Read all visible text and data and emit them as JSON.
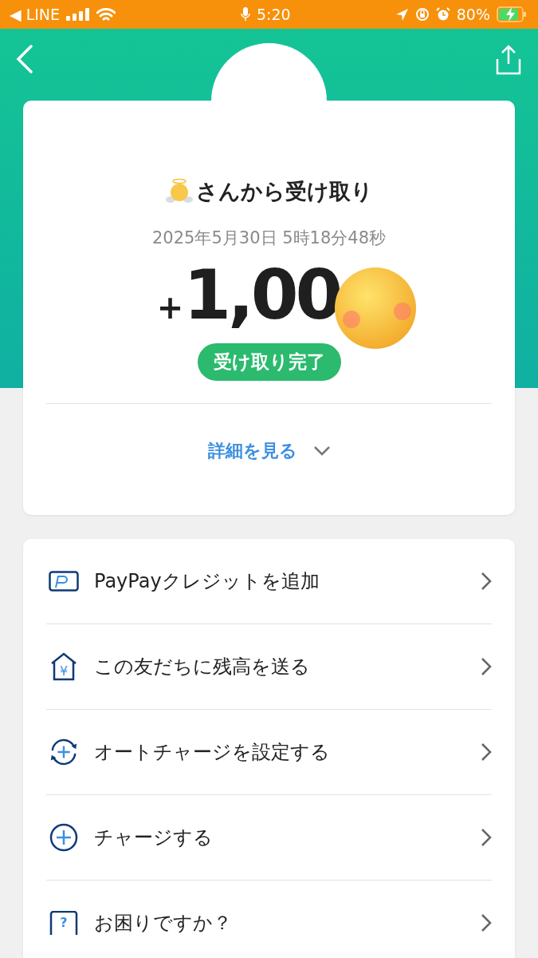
{
  "status_bar": {
    "back_app": "◀ LINE",
    "time": "5:20",
    "battery": "80%",
    "charging": true
  },
  "transaction": {
    "title": "さんから受け取り",
    "datetime": "2025年5月30日 5時18分48秒",
    "sign": "+",
    "amount": "1,00",
    "status": "受け取り完了",
    "details_link": "詳細を見る",
    "expanded": false
  },
  "actions": [
    {
      "kind": "credit",
      "label": "PayPayクレジットを追加"
    },
    {
      "kind": "send",
      "label": "この友だちに残高を送る",
      "icon_glyph": "¥"
    },
    {
      "kind": "auto",
      "label": "オートチャージを設定する"
    },
    {
      "kind": "charge",
      "label": "チャージする"
    },
    {
      "kind": "help",
      "label": "お困りですか？",
      "icon_glyph": "?"
    }
  ]
}
